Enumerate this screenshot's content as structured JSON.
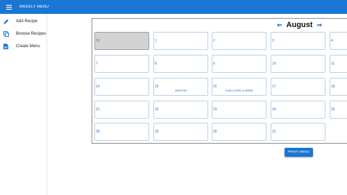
{
  "app": {
    "title": "WEEKLY MENU",
    "accent": "#1976d2"
  },
  "sidebar": {
    "items": [
      {
        "label": "Add Recipe",
        "icon": "pencil-icon"
      },
      {
        "label": "Browse Recipes",
        "icon": "copy-icon"
      },
      {
        "label": "Create Menu",
        "icon": "document-icon"
      }
    ]
  },
  "calendar": {
    "month": "August",
    "prev_arrow": "⇐",
    "next_arrow": "⇒",
    "days": [
      {
        "num": "31",
        "meal": "",
        "disabled": true
      },
      {
        "num": "1",
        "meal": ""
      },
      {
        "num": "2",
        "meal": ""
      },
      {
        "num": "3",
        "meal": ""
      },
      {
        "num": "4",
        "meal": ""
      },
      {
        "num": "7",
        "meal": ""
      },
      {
        "num": "8",
        "meal": ""
      },
      {
        "num": "9",
        "meal": ""
      },
      {
        "num": "10",
        "meal": ""
      },
      {
        "num": "11",
        "meal": ""
      },
      {
        "num": "14",
        "meal": ""
      },
      {
        "num": "15",
        "meal": "GRATIN"
      },
      {
        "num": "16",
        "meal": "CHILI CON CARNE"
      },
      {
        "num": "17",
        "meal": ""
      },
      {
        "num": "18",
        "meal": ""
      },
      {
        "num": "21",
        "meal": ""
      },
      {
        "num": "22",
        "meal": ""
      },
      {
        "num": "23",
        "meal": ""
      },
      {
        "num": "24",
        "meal": ""
      },
      {
        "num": "25",
        "meal": ""
      },
      {
        "num": "28",
        "meal": ""
      },
      {
        "num": "29",
        "meal": ""
      },
      {
        "num": "30",
        "meal": ""
      },
      {
        "num": "31",
        "meal": ""
      }
    ]
  },
  "actions": {
    "print_label": "PRINT MENU"
  }
}
